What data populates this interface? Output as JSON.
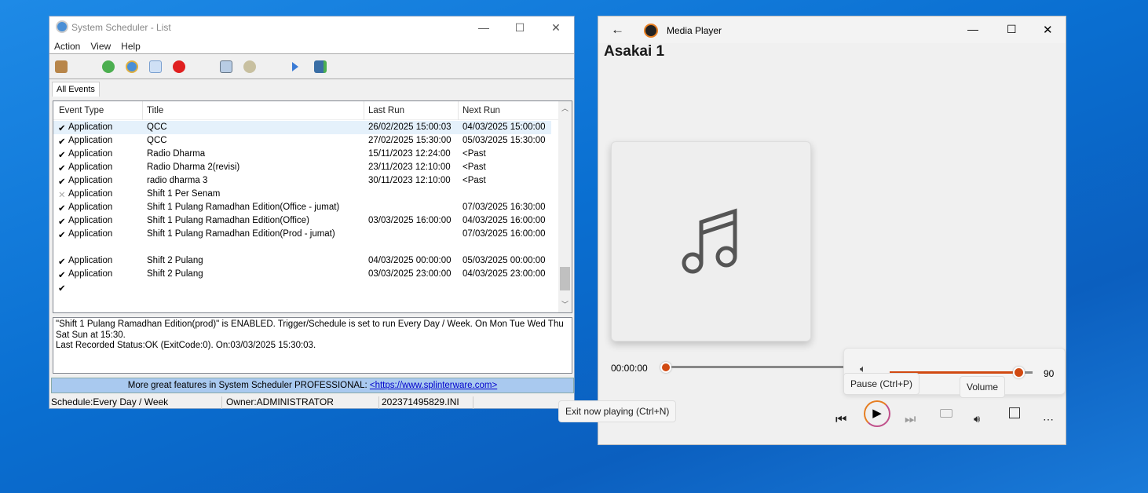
{
  "scheduler": {
    "title": "System Scheduler - List",
    "menu": [
      "Action",
      "View",
      "Help"
    ],
    "tab": "All Events",
    "columns": [
      "Event Type",
      "Title",
      "Last Run",
      "Next Run"
    ],
    "rows": [
      {
        "status": "✔",
        "type": "Application",
        "title": "QCC",
        "last": "26/02/2025 15:00:03",
        "next": "04/03/2025 15:00:00",
        "selected": true
      },
      {
        "status": "✔",
        "type": "Application",
        "title": "QCC",
        "last": "27/02/2025 15:30:00",
        "next": "05/03/2025 15:30:00"
      },
      {
        "status": "✔",
        "type": "Application",
        "title": "Radio Dharma",
        "last": "15/11/2023 12:24:00",
        "next": "<Past"
      },
      {
        "status": "✔",
        "type": "Application",
        "title": "Radio Dharma 2(revisi)",
        "last": "23/11/2023 12:10:00",
        "next": "<Past"
      },
      {
        "status": "✔",
        "type": "Application",
        "title": "radio dharma 3",
        "last": "30/11/2023 12:10:00",
        "next": "<Past"
      },
      {
        "status": "✕",
        "type": "Application",
        "title": "Shift 1 Per Senam",
        "last": "",
        "next": ""
      },
      {
        "status": "✔",
        "type": "Application",
        "title": "Shift 1 Pulang Ramadhan Edition(Office - jumat)",
        "last": "",
        "next": "07/03/2025 16:30:00"
      },
      {
        "status": "✔",
        "type": "Application",
        "title": "Shift 1 Pulang Ramadhan Edition(Office)",
        "last": "03/03/2025 16:00:00",
        "next": "04/03/2025 16:00:00"
      },
      {
        "status": "✔",
        "type": "Application",
        "title": "Shift 1 Pulang Ramadhan Edition(Prod - jumat)",
        "last": "",
        "next": "07/03/2025 16:00:00"
      },
      {
        "status": "",
        "type": "",
        "title": "",
        "last": "",
        "next": ""
      },
      {
        "status": "✔",
        "type": "Application",
        "title": "Shift 2 Pulang",
        "last": "04/03/2025 00:00:00",
        "next": "05/03/2025 00:00:00"
      },
      {
        "status": "✔",
        "type": "Application",
        "title": "Shift 2 Pulang",
        "last": "03/03/2025 23:00:00",
        "next": "04/03/2025 23:00:00"
      },
      {
        "status": "✔",
        "type": "",
        "title": "",
        "last": "",
        "next": ""
      }
    ],
    "description": [
      "\"Shift 1 Pulang Ramadhan Edition(prod)\" is ENABLED. Trigger/Schedule is set to run Every Day / Week. On Mon Tue Wed Thu Sat Sun at 15:30.",
      "Last Recorded Status:OK (ExitCode:0). On:03/03/2025 15:30:03."
    ],
    "promo_text": "More great features in System Scheduler PROFESSIONAL: ",
    "promo_link": "<https://www.splinterware.com>",
    "status": {
      "schedule": "Schedule:Every Day / Week",
      "owner": "Owner:ADMINISTRATOR",
      "file": "202371495829.INI"
    }
  },
  "media": {
    "app_title": "Media Player",
    "track": "Asakai 1",
    "time": "00:00:00",
    "volume": 90,
    "volume_label": "90",
    "tooltips": {
      "pause": "Pause (Ctrl+P)",
      "volume": "Volume",
      "exit": "Exit now playing (Ctrl+N)"
    },
    "accent": "#d14a12"
  }
}
